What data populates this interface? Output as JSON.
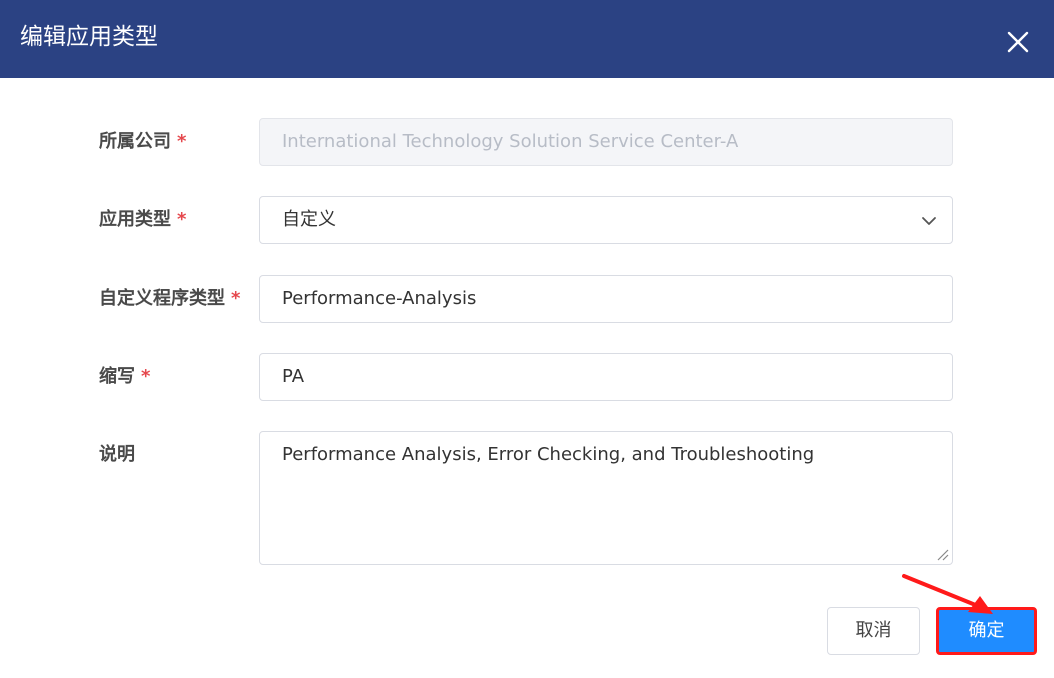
{
  "dialog": {
    "title": "编辑应用类型",
    "close_icon": "close-icon"
  },
  "form": {
    "company": {
      "label": "所属公司",
      "required": "*",
      "value": "International Technology Solution Service Center-A"
    },
    "app_type": {
      "label": "应用类型",
      "required": "*",
      "value": "自定义",
      "icon": "chevron-down-icon"
    },
    "custom_program_type": {
      "label": "自定义程序类型",
      "required": "*",
      "value": "Performance-Analysis"
    },
    "abbreviation": {
      "label": "缩写",
      "required": "*",
      "value": "PA"
    },
    "description": {
      "label": "说明",
      "value": "Performance Analysis, Error Checking, and Troubleshooting"
    }
  },
  "footer": {
    "cancel_label": "取消",
    "ok_label": "确定"
  },
  "colors": {
    "header_bg": "#2b4283",
    "primary": "#1f8cff",
    "required": "#e5484d",
    "annotation": "#ff1a1a"
  }
}
